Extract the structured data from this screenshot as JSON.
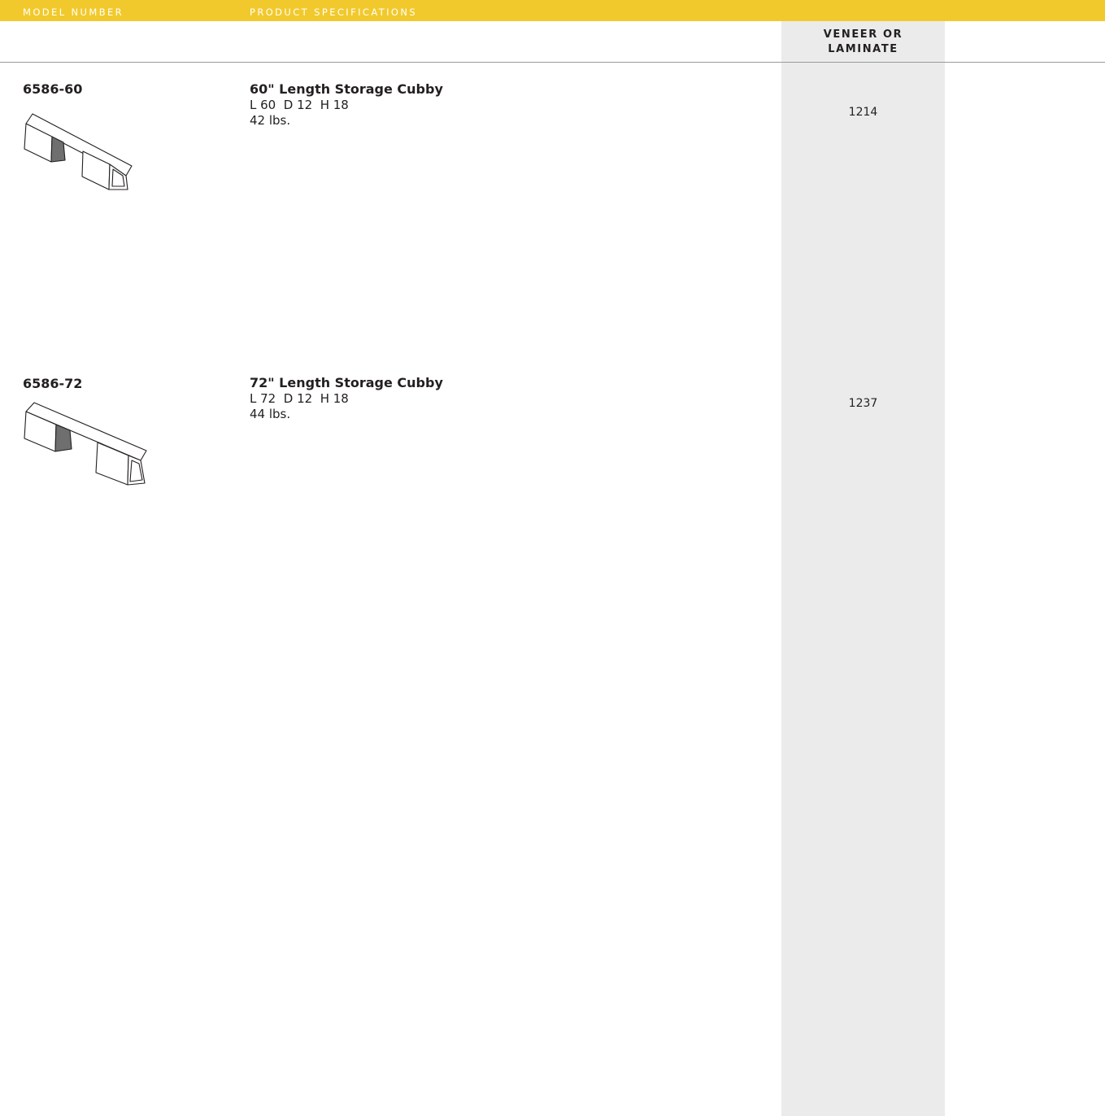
{
  "header": {
    "model_number_label": "MODEL NUMBER",
    "product_specifications_label": "PRODUCT SPECIFICATIONS",
    "accent_color": "#f2c92c"
  },
  "price_column": {
    "heading_line1": "VENEER OR",
    "heading_line2": "LAMINATE",
    "background_color": "#eaebea"
  },
  "products": [
    {
      "model": "6586-60",
      "name": "60\" Length Storage Cubby",
      "dimensions": "L 60  D 12  H 18",
      "weight": "42 lbs.",
      "price": "1214",
      "image": "storage-cubby-illustration"
    },
    {
      "model": "6586-72",
      "name": "72\" Length Storage Cubby",
      "dimensions": "L 72  D 12  H 18",
      "weight": "44 lbs.",
      "price": "1237",
      "image": "storage-cubby-illustration"
    }
  ]
}
